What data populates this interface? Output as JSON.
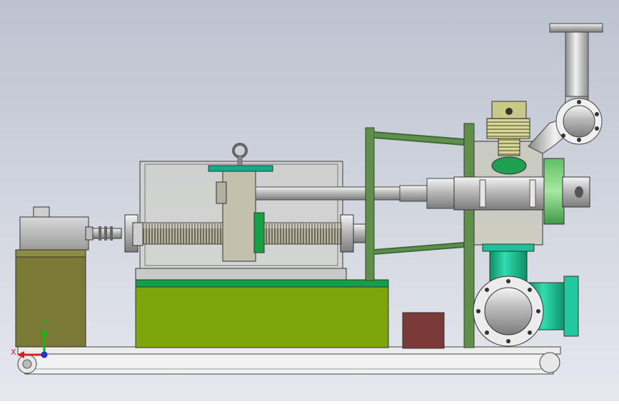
{
  "viewport": {
    "background_top": "#bcc2cf",
    "background_bottom": "#e6e8ee"
  },
  "triad": {
    "y_label": "Y",
    "x_label": "X",
    "y_color": "#17b317",
    "x_color": "#d42020",
    "z_color": "#1a3cd4"
  },
  "model": {
    "parts": [
      "base-rail",
      "gear-motor",
      "motor-gearbox",
      "coupling",
      "bearing-block-left",
      "bearing-block-right",
      "lead-screw",
      "screw-nut-carriage",
      "lifting-eye",
      "transparent-enclosure",
      "green-base-platform",
      "support-frame",
      "push-rod",
      "valve-body",
      "bellows",
      "elbow-pipe",
      "flanged-pipe",
      "teal-tee-pipe",
      "control-box"
    ],
    "colors": {
      "olive": "#7a7a36",
      "green_platform": "#7da60c",
      "green_stripe": "#13a04b",
      "frame_green": "#5f8f4a",
      "teal": "#17b890",
      "maroon": "#7a3a38",
      "steel": "#c8c8c8",
      "bellows": "#c8c887"
    }
  }
}
